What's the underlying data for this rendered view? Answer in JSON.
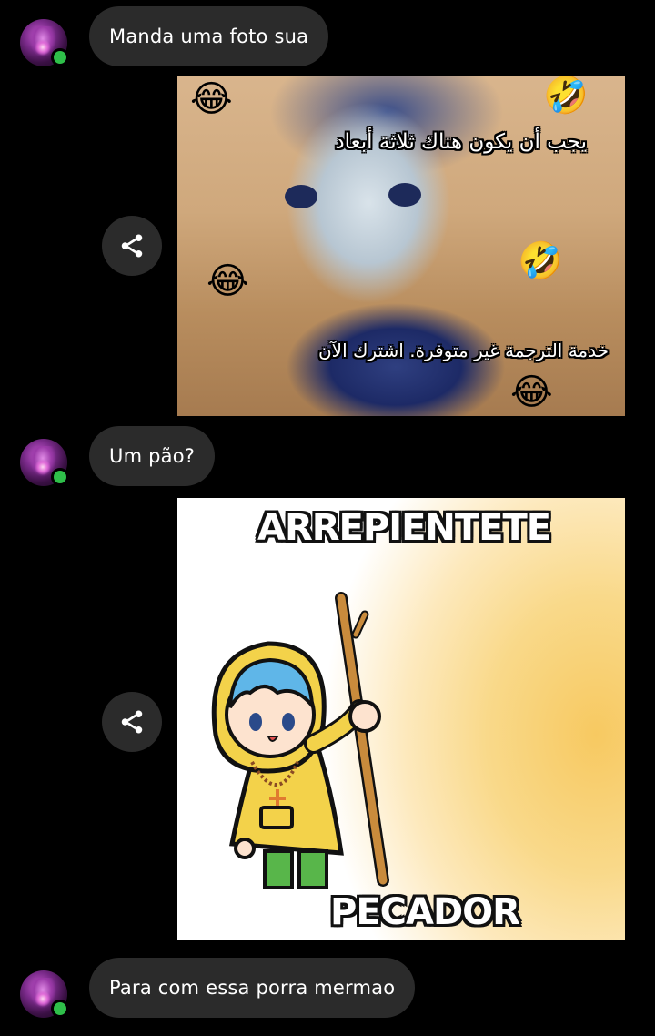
{
  "messages": [
    {
      "type": "text",
      "text": "Manda uma foto sua"
    },
    {
      "type": "image",
      "captions": [
        "يجب أن يكون هناك ثلاثة أبعاد",
        "خدمة الترجمة غير متوفرة. اشترك الآن"
      ],
      "emojis": [
        "😂",
        "🤣",
        "😂",
        "🤣",
        "😂"
      ]
    },
    {
      "type": "text",
      "text": "Um pão?"
    },
    {
      "type": "image",
      "captions": [
        "ARREPIENTETE",
        "PECADOR"
      ]
    },
    {
      "type": "text",
      "text": "Para com essa porra mermao"
    }
  ],
  "icons": {
    "share": "share-icon",
    "avatar": "avatar",
    "presence": "online-dot"
  },
  "colors": {
    "background": "#000000",
    "bubble": "#2b2b2b",
    "online": "#2fbf4a",
    "text": "#ffffff"
  }
}
